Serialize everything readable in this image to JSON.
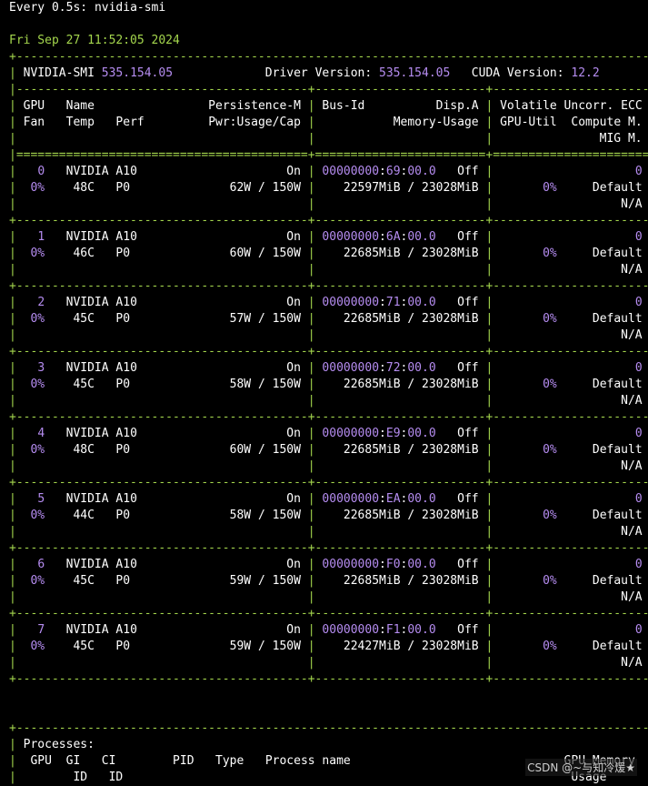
{
  "header": {
    "command_prefix": "Every 0.5s",
    "command": "nvidia-smi",
    "datetime": "Fri Sep 27 11:52:05 2024"
  },
  "smi": {
    "label": "NVIDIA-SMI",
    "version": "535.154.05",
    "driver_label": "Driver Version:",
    "driver_version": "535.154.05",
    "cuda_label": "CUDA Version:",
    "cuda_version": "12.2"
  },
  "columns": {
    "row1": [
      "GPU",
      "Name",
      "Persistence-M",
      "Bus-Id",
      "Disp.A",
      "Volatile Uncorr. ECC"
    ],
    "row2": [
      "Fan",
      "Temp",
      "Perf",
      "Pwr:Usage/Cap",
      "Memory-Usage",
      "GPU-Util",
      "Compute M."
    ],
    "row3": [
      "MIG M."
    ]
  },
  "gpus": [
    {
      "index": "0",
      "name": "NVIDIA A10",
      "persistence": "On",
      "bus_prefix": "00000000",
      "bus_id": "69",
      "bus_suffix": "00.0",
      "disp": "Off",
      "ecc": "0",
      "fan": "0%",
      "temp": "48C",
      "perf": "P0",
      "power": "62W / 150W",
      "memory": "22597MiB / 23028MiB",
      "util": "0%",
      "compute": "Default",
      "mig": "N/A"
    },
    {
      "index": "1",
      "name": "NVIDIA A10",
      "persistence": "On",
      "bus_prefix": "00000000",
      "bus_id": "6A",
      "bus_suffix": "00.0",
      "disp": "Off",
      "ecc": "0",
      "fan": "0%",
      "temp": "46C",
      "perf": "P0",
      "power": "60W / 150W",
      "memory": "22685MiB / 23028MiB",
      "util": "0%",
      "compute": "Default",
      "mig": "N/A"
    },
    {
      "index": "2",
      "name": "NVIDIA A10",
      "persistence": "On",
      "bus_prefix": "00000000",
      "bus_id": "71",
      "bus_suffix": "00.0",
      "disp": "Off",
      "ecc": "0",
      "fan": "0%",
      "temp": "45C",
      "perf": "P0",
      "power": "57W / 150W",
      "memory": "22685MiB / 23028MiB",
      "util": "0%",
      "compute": "Default",
      "mig": "N/A"
    },
    {
      "index": "3",
      "name": "NVIDIA A10",
      "persistence": "On",
      "bus_prefix": "00000000",
      "bus_id": "72",
      "bus_suffix": "00.0",
      "disp": "Off",
      "ecc": "0",
      "fan": "0%",
      "temp": "45C",
      "perf": "P0",
      "power": "58W / 150W",
      "memory": "22685MiB / 23028MiB",
      "util": "0%",
      "compute": "Default",
      "mig": "N/A"
    },
    {
      "index": "4",
      "name": "NVIDIA A10",
      "persistence": "On",
      "bus_prefix": "00000000",
      "bus_id": "E9",
      "bus_suffix": "00.0",
      "disp": "Off",
      "ecc": "0",
      "fan": "0%",
      "temp": "48C",
      "perf": "P0",
      "power": "60W / 150W",
      "memory": "22685MiB / 23028MiB",
      "util": "0%",
      "compute": "Default",
      "mig": "N/A"
    },
    {
      "index": "5",
      "name": "NVIDIA A10",
      "persistence": "On",
      "bus_prefix": "00000000",
      "bus_id": "EA",
      "bus_suffix": "00.0",
      "disp": "Off",
      "ecc": "0",
      "fan": "0%",
      "temp": "44C",
      "perf": "P0",
      "power": "58W / 150W",
      "memory": "22685MiB / 23028MiB",
      "util": "0%",
      "compute": "Default",
      "mig": "N/A"
    },
    {
      "index": "6",
      "name": "NVIDIA A10",
      "persistence": "On",
      "bus_prefix": "00000000",
      "bus_id": "F0",
      "bus_suffix": "00.0",
      "disp": "Off",
      "ecc": "0",
      "fan": "0%",
      "temp": "45C",
      "perf": "P0",
      "power": "59W / 150W",
      "memory": "22685MiB / 23028MiB",
      "util": "0%",
      "compute": "Default",
      "mig": "N/A"
    },
    {
      "index": "7",
      "name": "NVIDIA A10",
      "persistence": "On",
      "bus_prefix": "00000000",
      "bus_id": "F1",
      "bus_suffix": "00.0",
      "disp": "Off",
      "ecc": "0",
      "fan": "0%",
      "temp": "45C",
      "perf": "P0",
      "power": "59W / 150W",
      "memory": "22427MiB / 23028MiB",
      "util": "0%",
      "compute": "Default",
      "mig": "N/A"
    }
  ],
  "processes": {
    "title": "Processes:",
    "headers": [
      "GPU",
      "GI",
      "CI",
      "PID",
      "Type",
      "Process name",
      "GPU Memory"
    ],
    "headers2": [
      "ID",
      "ID",
      "Usage"
    ]
  },
  "watermark": "CSDN @~与知冷煖★",
  "colors": {
    "background": "#000000",
    "border": "#a4d64d",
    "number": "#b58cf0",
    "text": "#ffffff"
  }
}
